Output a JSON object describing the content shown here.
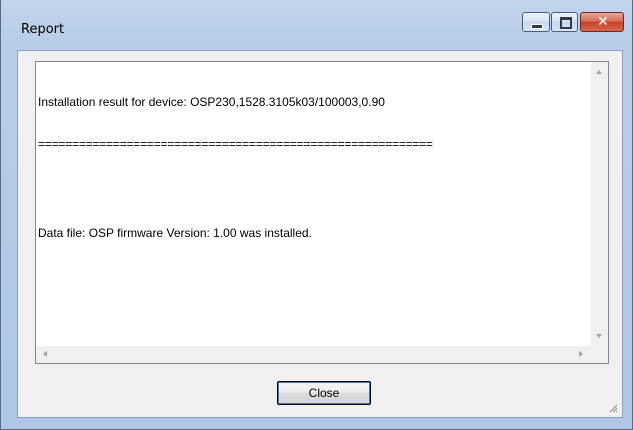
{
  "window": {
    "title": "Report"
  },
  "report": {
    "lines": [
      "Installation result for device: OSP230,1528.3105k03/100003,0.90",
      "==========================================================",
      "",
      "Data file: OSP firmware Version: 1.00 was installed."
    ]
  },
  "buttons": {
    "close_label": "Close"
  },
  "icons": {
    "minimize": "minimize-icon",
    "maximize": "maximize-icon",
    "close": "close-icon",
    "scroll_up": "arrow-up-icon",
    "scroll_down": "arrow-down-icon",
    "scroll_left": "arrow-left-icon",
    "scroll_right": "arrow-right-icon",
    "resize": "resize-grip-icon"
  },
  "colors": {
    "window_frame": "#b9cde8",
    "close_caption": "#c4432a",
    "client_bg": "#f0f0f0"
  }
}
